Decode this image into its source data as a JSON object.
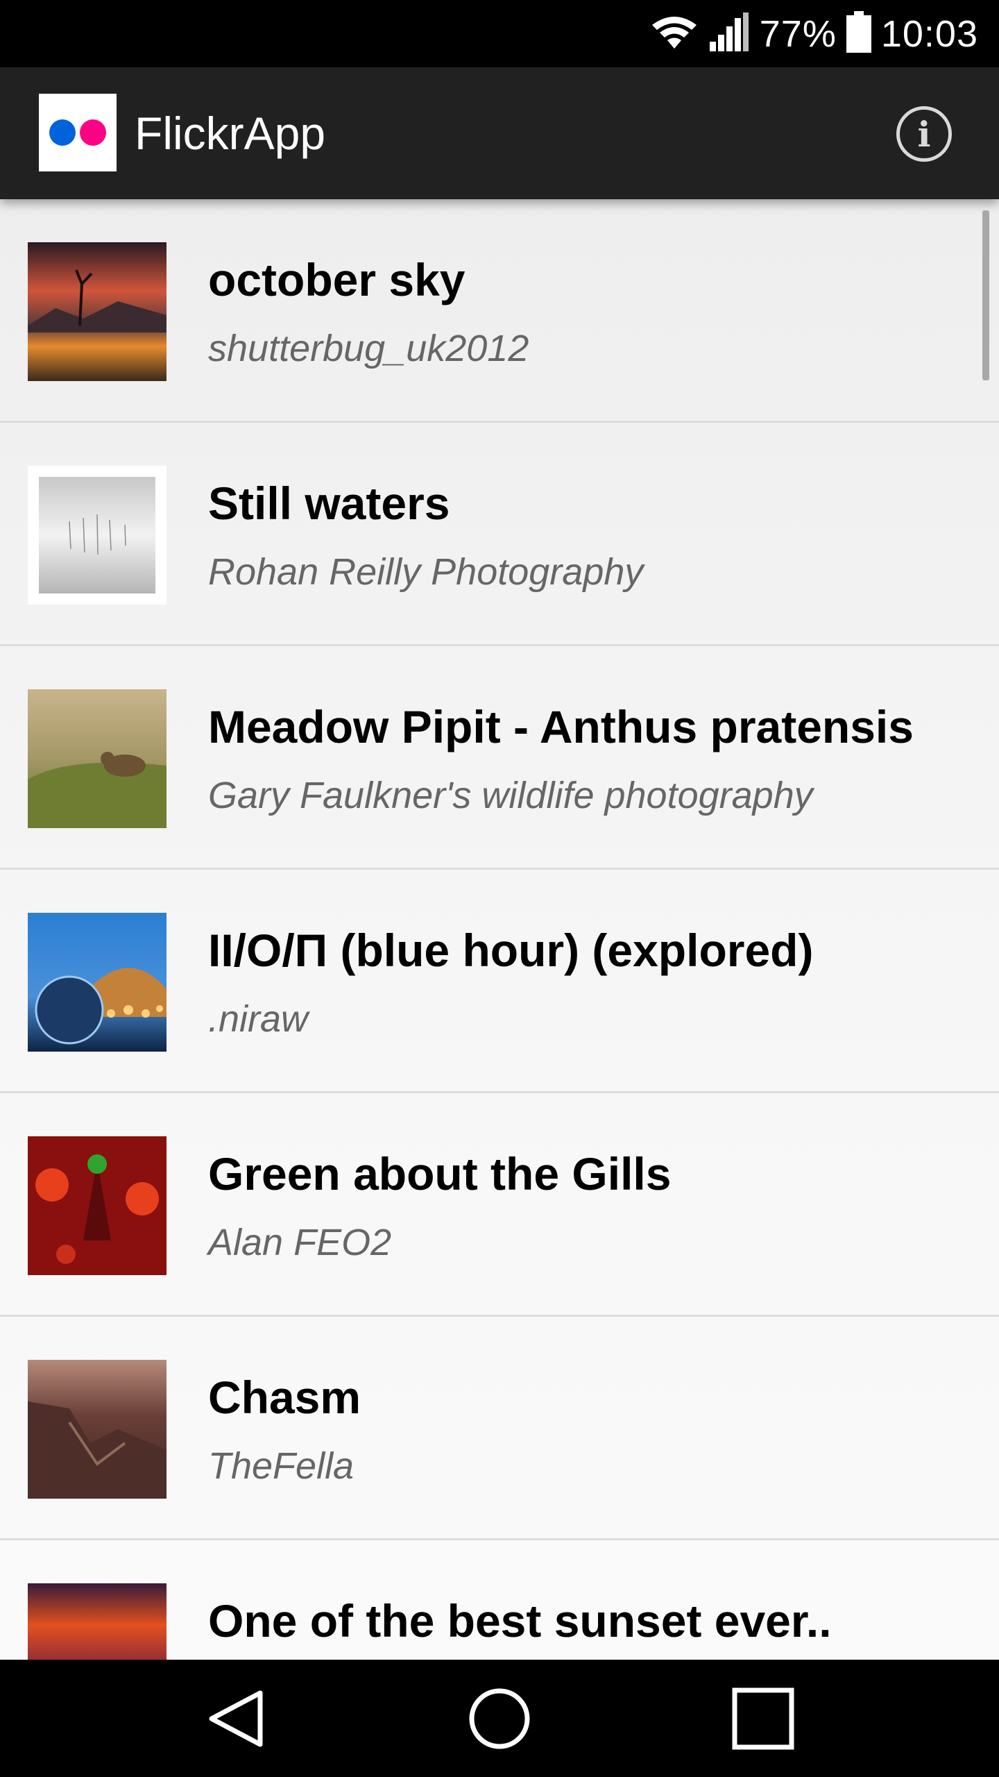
{
  "status_bar": {
    "battery": "77%",
    "time": "10:03",
    "icons": [
      "wifi-icon",
      "signal-icon",
      "battery-icon"
    ]
  },
  "app_bar": {
    "title": "FlickrApp",
    "logo_colors": [
      "#0063dc",
      "#ff0084"
    ],
    "info_icon": "info-icon",
    "info_glyph": "i"
  },
  "photos": [
    {
      "title": "october sky",
      "author": "shutterbug_uk2012"
    },
    {
      "title": "Still waters",
      "author": "Rohan Reilly Photography"
    },
    {
      "title": "Meadow Pipit - Anthus pratensis",
      "author": "Gary Faulkner's wildlife photography"
    },
    {
      "title": "ІІ/О/П (blue hour) (explored)",
      "author": ".niraw"
    },
    {
      "title": "Green about the Gills",
      "author": "Alan FEO2"
    },
    {
      "title": "Chasm",
      "author": "TheFella"
    },
    {
      "title": "One of the best sunset ever..",
      "author": ""
    }
  ],
  "nav_bar": {
    "icons": [
      "back-icon",
      "home-icon",
      "recents-icon"
    ]
  }
}
